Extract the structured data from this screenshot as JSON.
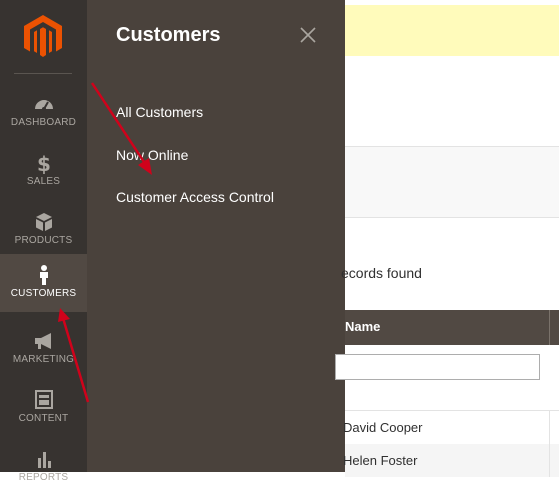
{
  "nav": {
    "items": [
      {
        "label": "DASHBOARD",
        "icon": "dashboard-icon"
      },
      {
        "label": "SALES",
        "icon": "dollar-icon"
      },
      {
        "label": "PRODUCTS",
        "icon": "box-icon"
      },
      {
        "label": "CUSTOMERS",
        "icon": "person-icon",
        "active": true
      },
      {
        "label": "MARKETING",
        "icon": "megaphone-icon"
      },
      {
        "label": "CONTENT",
        "icon": "layout-icon"
      },
      {
        "label": "REPORTS",
        "icon": "bar-chart-icon"
      }
    ]
  },
  "flyout": {
    "title": "Customers",
    "links": [
      "All Customers",
      "Now Online",
      "Customer Access Control"
    ]
  },
  "grid": {
    "records_text": "ecords found",
    "column_name": "Name",
    "rows": [
      "David Cooper",
      "Helen Foster"
    ]
  },
  "colors": {
    "nav_bg": "#373330",
    "flyout_bg": "#4a423c",
    "active_bg": "#514943",
    "logo": "#eb5202",
    "arrow": "#d0021b",
    "notice_bg": "#fffbbb"
  }
}
